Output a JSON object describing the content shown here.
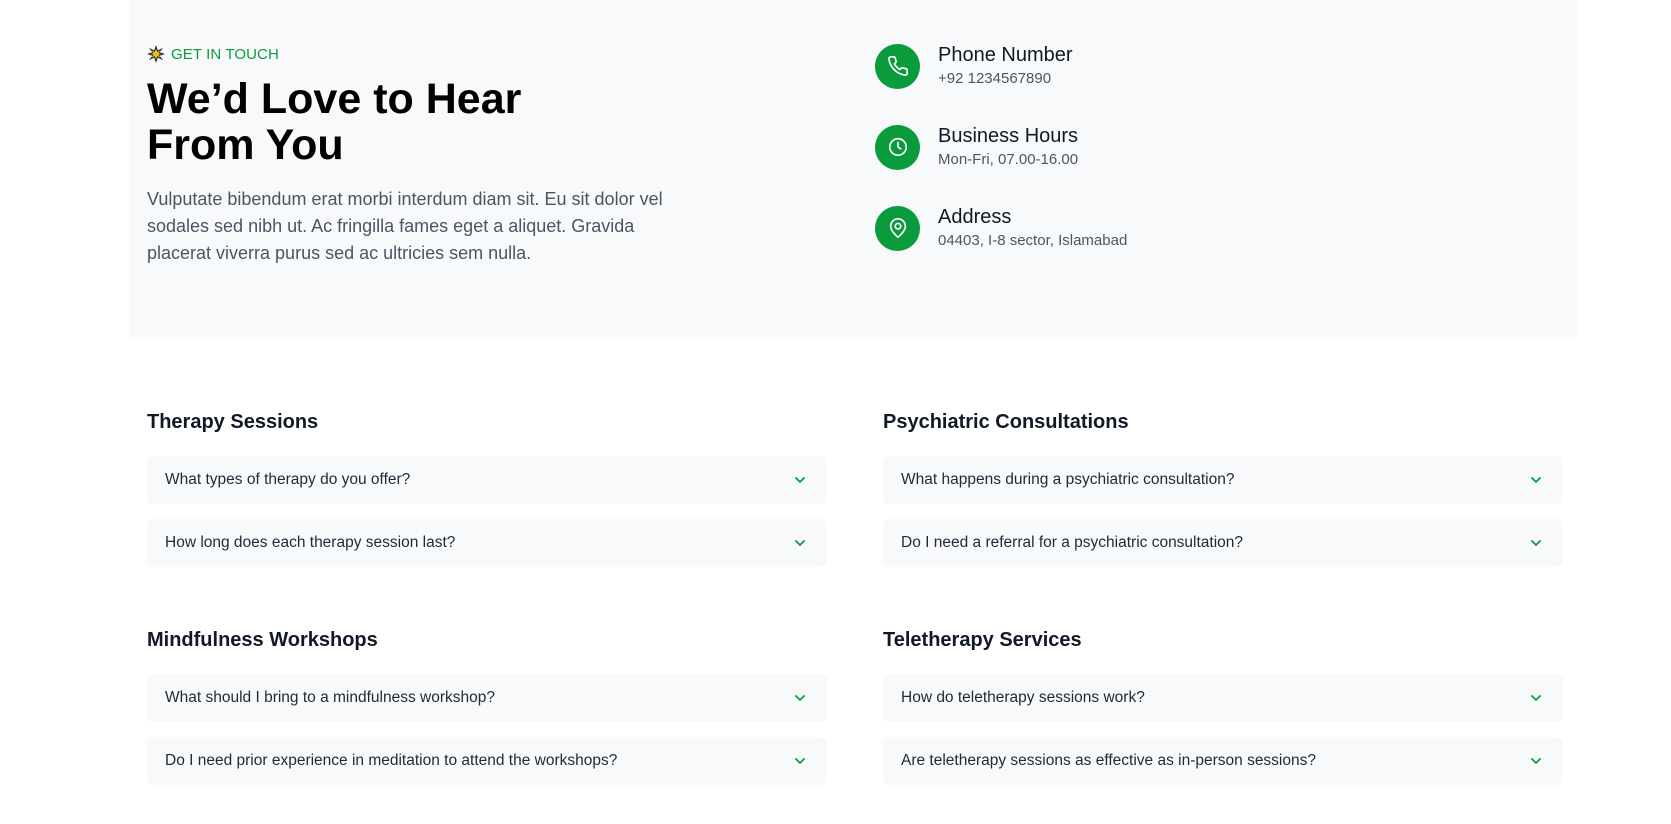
{
  "contact": {
    "eyebrow": "GET IN TOUCH",
    "eyebrow_icon": "sparkle-icon",
    "headline": "We’d Love to Hear From You",
    "description": "Vulputate bibendum erat morbi interdum diam sit. Eu sit dolor vel sodales sed nibh ut. Ac fringilla fames eget a aliquet. Gravida placerat viverra purus sed ac ultricies sem nulla.",
    "info": [
      {
        "icon": "phone-icon",
        "title": "Phone Number",
        "value": "+92 1234567890"
      },
      {
        "icon": "clock-icon",
        "title": "Business Hours",
        "value": "Mon-Fri, 07.00-16.00"
      },
      {
        "icon": "map-pin-icon",
        "title": "Address",
        "value": "04403, I-8 sector, Islamabad"
      }
    ]
  },
  "faq": [
    {
      "heading": "Therapy Sessions",
      "items": [
        "What types of therapy do you offer?",
        "How long does each therapy session last?"
      ]
    },
    {
      "heading": "Psychiatric Consultations",
      "items": [
        "What happens during a psychiatric consultation?",
        "Do I need a referral for a psychiatric consultation?"
      ]
    },
    {
      "heading": "Mindfulness Workshops",
      "items": [
        "What should I bring to a mindfulness workshop?",
        "Do I need prior experience in meditation to attend the workshops?"
      ]
    },
    {
      "heading": "Teletherapy Services",
      "items": [
        "How do teletherapy sessions work?",
        "Are teletherapy sessions as effective as in-person sessions?"
      ]
    }
  ],
  "colors": {
    "accent": "#0a9b3c",
    "band_background": "#f8f9fa"
  }
}
